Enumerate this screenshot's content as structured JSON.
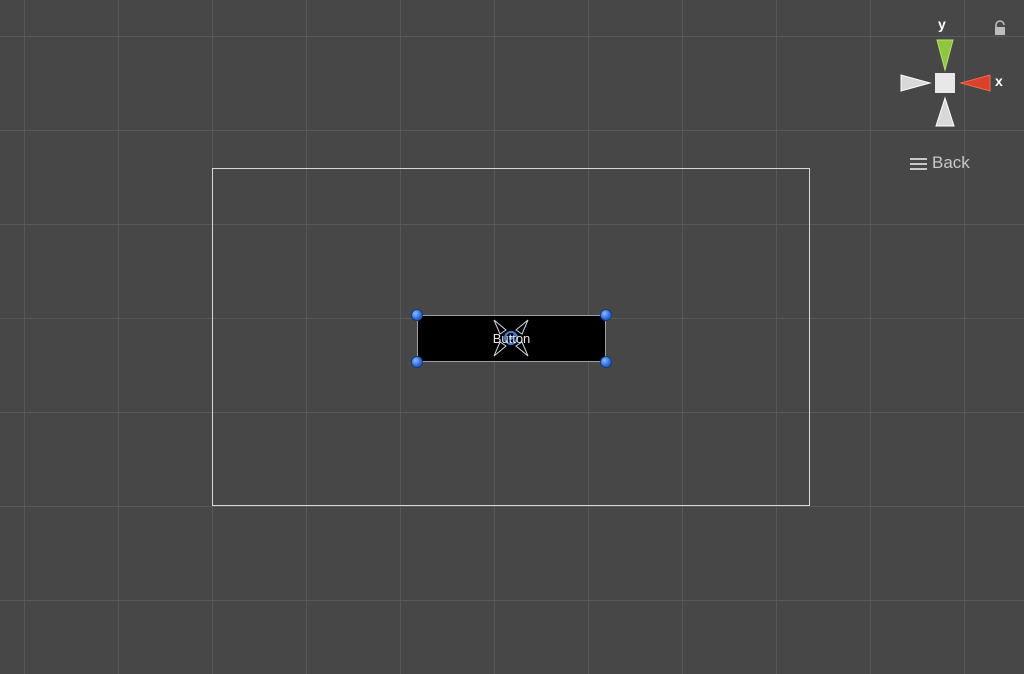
{
  "scene": {
    "button_label": "Button"
  },
  "gizmo": {
    "y_label": "y",
    "x_label": "x",
    "y_axis_color": "#8ec63f",
    "x_axis_color": "#d9412a"
  },
  "view_menu": {
    "back_label": "Back"
  },
  "icons": {
    "lock": "lock-icon",
    "menu": "hamburger-menu-icon",
    "pivot": "pivot-icon"
  }
}
